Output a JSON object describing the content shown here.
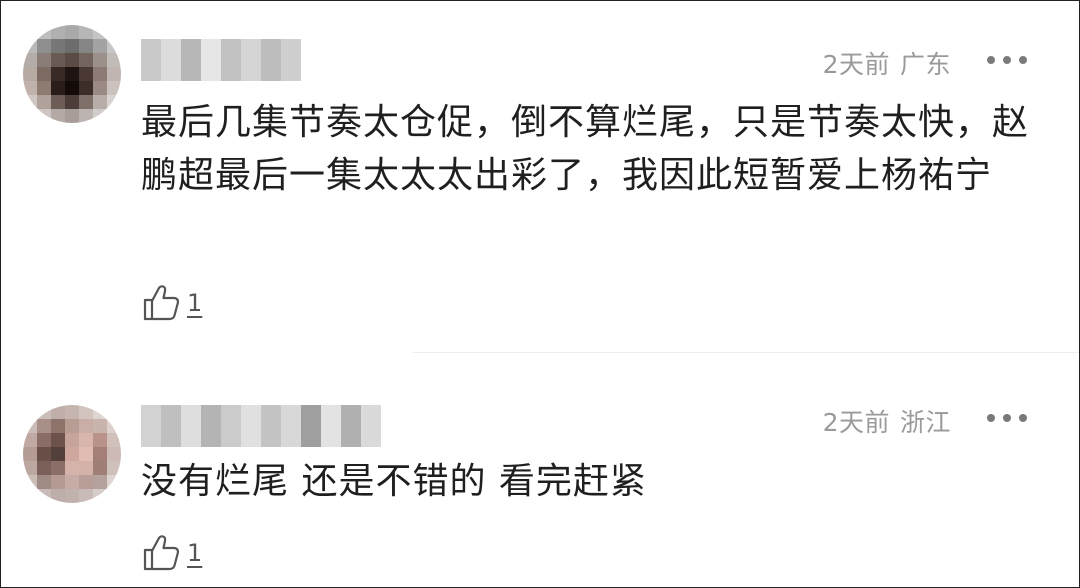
{
  "comments": [
    {
      "time": "2天前",
      "location": "广东",
      "text": "最后几集节奏太仓促，倒不算烂尾，只是节奏太快，赵鹏超最后一集太太太出彩了，我因此短暂爱上杨祐宁",
      "likes": "1"
    },
    {
      "time": "2天前",
      "location": "浙江",
      "text": "没有烂尾 还是不错的 看完赶紧",
      "likes": "1"
    }
  ],
  "icons": {
    "like": "thumbs-up-icon",
    "more": "more-dots-icon"
  },
  "colors": {
    "text": "#1f1f1f",
    "meta": "#9a9a9a",
    "divider": "#ececec"
  }
}
